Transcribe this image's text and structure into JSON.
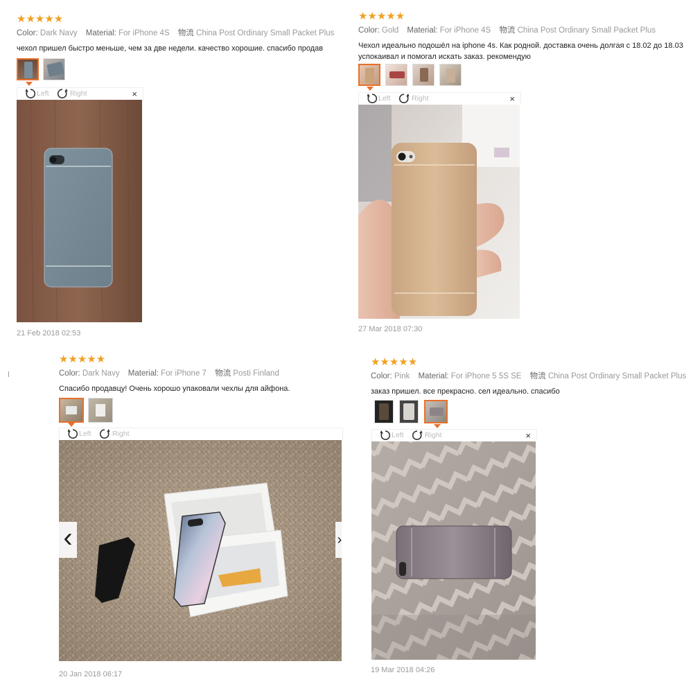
{
  "labels": {
    "color": "Color:",
    "material": "Material:",
    "shipping": "物流",
    "left": "Left",
    "right": "Right",
    "close": "×",
    "prev": "‹"
  },
  "stars": "★★★★★",
  "reviews": [
    {
      "color": "Dark Navy",
      "material": "For iPhone 4S",
      "shipping": "China Post Ordinary Small Packet Plus",
      "text": "чехол пришел быстро меньше, чем за две недели. качество хорошие. спасибо продав",
      "date": "21 Feb 2018 02:53"
    },
    {
      "color": "Gold",
      "material": "For iPhone 4S",
      "shipping": "China Post Ordinary Small Packet Plus",
      "text": "Чехол идеально подошёл на iphone 4s. Как родной. доставка очень долгая с 18.02 до 18.03 успокаивал и помогал искать заказ. рекомендую",
      "date": "27 Mar 2018 07:30"
    },
    {
      "color": "Dark Navy",
      "material": "For iPhone 7",
      "shipping": "Posti Finland",
      "text": "Спасибо продавцу! Очень хорошо упаковали чехлы для айфона.",
      "date": "20 Jan 2018 06:17"
    },
    {
      "color": "Pink",
      "material": "For iPhone 5 5S SE",
      "shipping": "China Post Ordinary Small Packet Plus",
      "text": "заказ пришел. все прекрасно. сел идеально. спасибо",
      "date": "19 Mar 2018 04:26"
    }
  ],
  "colors": {
    "star": "#f0a020",
    "selected_thumb": "#e8702a"
  }
}
